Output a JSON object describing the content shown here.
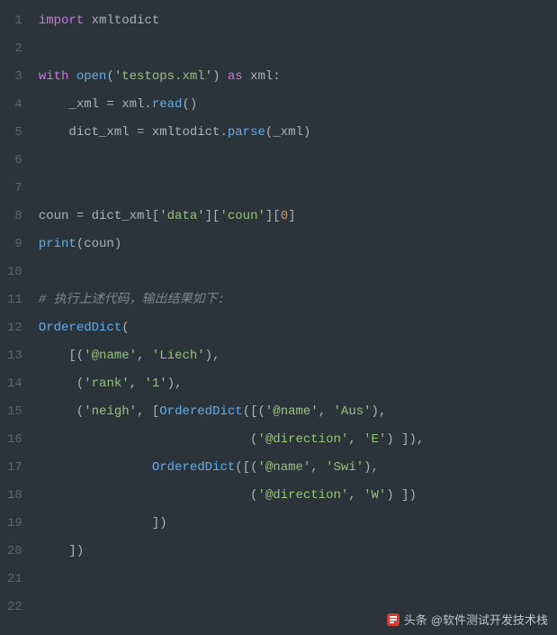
{
  "editor": {
    "lineNumbers": [
      "1",
      "2",
      "3",
      "4",
      "5",
      "6",
      "7",
      "8",
      "9",
      "10",
      "11",
      "12",
      "13",
      "14",
      "15",
      "16",
      "17",
      "18",
      "19",
      "20",
      "21",
      "22"
    ],
    "code": {
      "line1": {
        "t1": "import",
        "t2": " xmltodict"
      },
      "line2": {
        "t1": ""
      },
      "line3": {
        "t1": "with",
        "t2": " ",
        "t3": "open",
        "t4": "(",
        "t5": "'testops.xml'",
        "t6": ")",
        "t7": " ",
        "t8": "as",
        "t9": " xml:"
      },
      "line4": {
        "t1": "    _xml = xml.",
        "t2": "read",
        "t3": "()"
      },
      "line5": {
        "t1": "    dict_xml = xmltodict.",
        "t2": "parse",
        "t3": "(_xml)"
      },
      "line6": {
        "t1": ""
      },
      "line7": {
        "t1": ""
      },
      "line8": {
        "t1": "coun = dict_xml[",
        "t2": "'data'",
        "t3": "][",
        "t4": "'coun'",
        "t5": "][",
        "t6": "0",
        "t7": "]"
      },
      "line9": {
        "t1": "print",
        "t2": "(coun)"
      },
      "line10": {
        "t1": ""
      },
      "line11": {
        "t1": "# 执行上述代码，输出结果如下:"
      },
      "line12": {
        "t1": "OrderedDict",
        "t2": "("
      },
      "line13": {
        "t1": "    [(",
        "t2": "'@name'",
        "t3": ", ",
        "t4": "'Liech'",
        "t5": "),"
      },
      "line14": {
        "t1": "     (",
        "t2": "'rank'",
        "t3": ", ",
        "t4": "'1'",
        "t5": "),"
      },
      "line15": {
        "t1": "     (",
        "t2": "'neigh'",
        "t3": ", [",
        "t4": "OrderedDict",
        "t5": "([(",
        "t6": "'@name'",
        "t7": ", ",
        "t8": "'Aus'",
        "t9": "),"
      },
      "line16": {
        "t1": "                            (",
        "t2": "'@direction'",
        "t3": ", ",
        "t4": "'E'",
        "t5": ") ]),"
      },
      "line17": {
        "t1": "               ",
        "t2": "OrderedDict",
        "t3": "([(",
        "t4": "'@name'",
        "t5": ", ",
        "t6": "'Swi'",
        "t7": "),"
      },
      "line18": {
        "t1": "                            (",
        "t2": "'@direction'",
        "t3": ", ",
        "t4": "'W'",
        "t5": ") ])"
      },
      "line19": {
        "t1": "               ])"
      },
      "line20": {
        "t1": "    ])"
      },
      "line21": {
        "t1": ""
      },
      "line22": {
        "t1": ""
      }
    }
  },
  "watermark": {
    "prefix": "头条",
    "handle": "@软件测试开发技术栈"
  }
}
